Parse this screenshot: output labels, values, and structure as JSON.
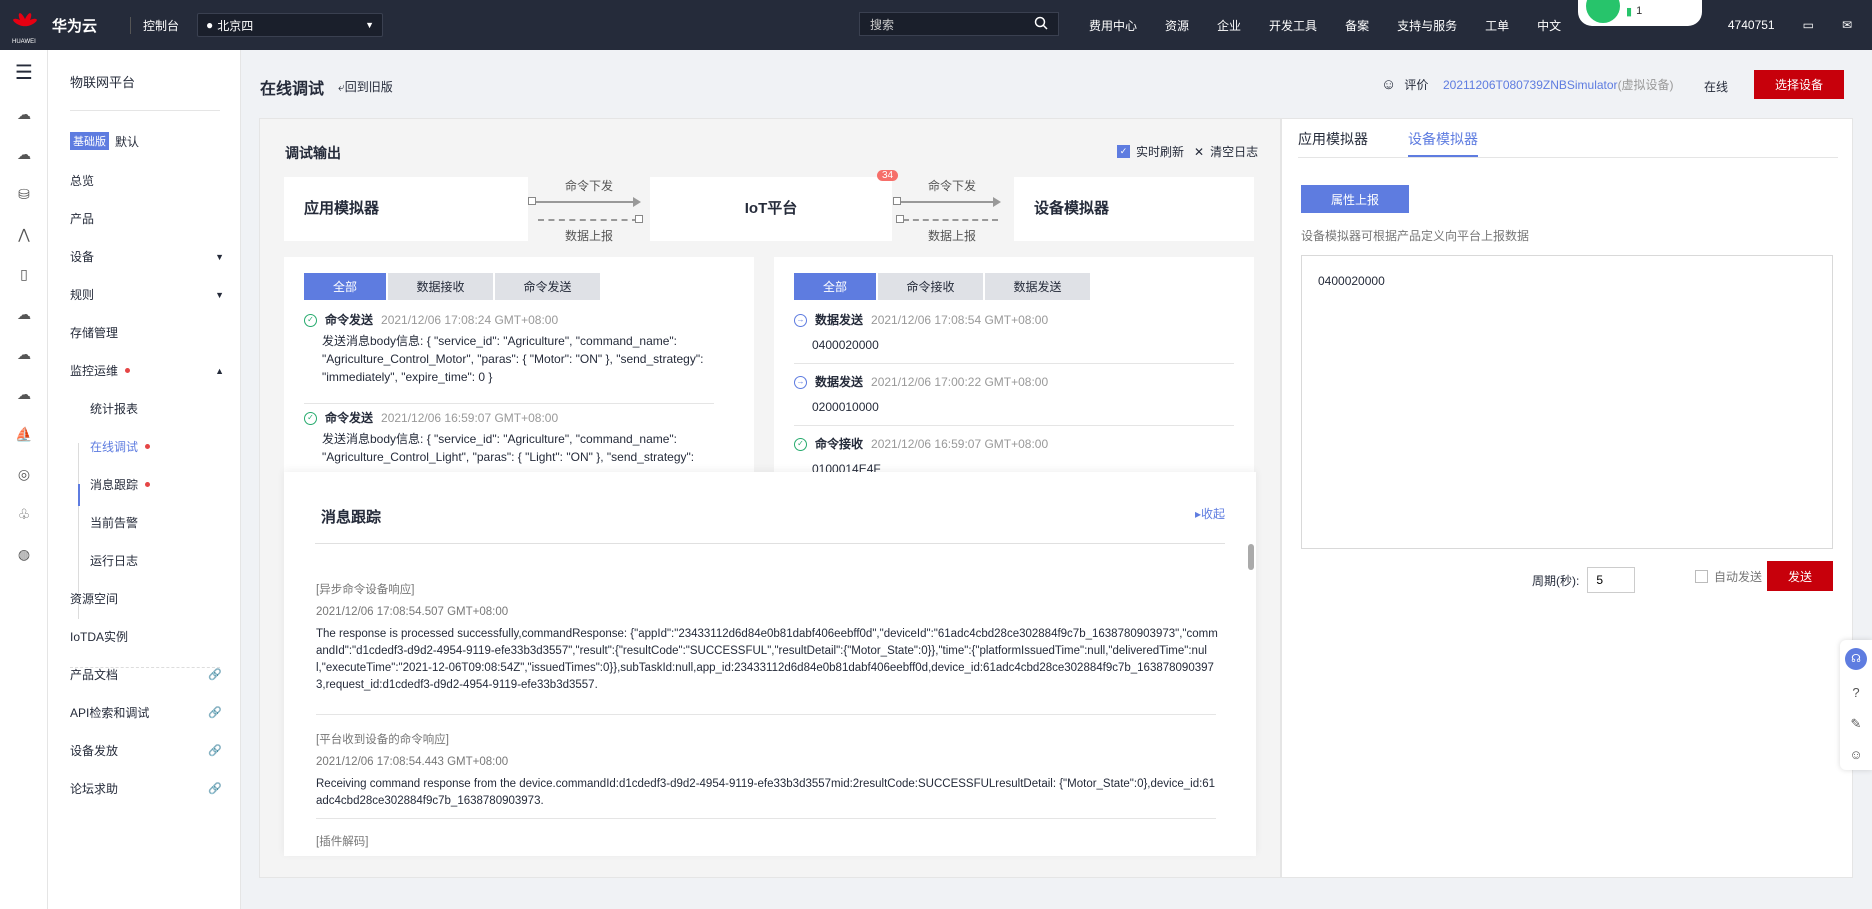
{
  "topbar": {
    "brand": "华为云",
    "brand_sub": "HUAWEI",
    "console": "控制台",
    "region": "北京四",
    "search_placeholder": "搜索",
    "nav": [
      "费用中心",
      "资源",
      "企业",
      "开发工具",
      "备案",
      "支持与服务",
      "工单",
      "中文"
    ],
    "account_tail": "4740751",
    "wifi_count": "1"
  },
  "sidebar": {
    "title": "物联网平台",
    "edition_badge": "基础版",
    "edition_name": "默认",
    "items": [
      "总览",
      "产品",
      "设备",
      "规则",
      "存储管理",
      "监控运维"
    ],
    "sub_items": [
      "统计报表",
      "在线调试",
      "消息跟踪",
      "当前告警",
      "运行日志"
    ],
    "bottom_items": [
      "资源空间",
      "IoTDA实例",
      "产品文档",
      "API检索和调试",
      "设备发放",
      "论坛求助"
    ]
  },
  "header": {
    "title": "在线调试",
    "back_old": "回到旧版",
    "rate": "评价",
    "device_name": "20211206T080739ZNBSimulator",
    "device_tag": "(虚拟设备)",
    "status": "在线",
    "select_device": "选择设备"
  },
  "debug": {
    "title": "调试输出",
    "realtime": "实时刷新",
    "clear_log": "清空日志",
    "app_sim": "应用模拟器",
    "iot_platform": "IoT平台",
    "dev_sim": "设备模拟器",
    "cmd_down": "命令下发",
    "data_up": "数据上报",
    "badge": "34",
    "left_tabs": [
      "全部",
      "数据接收",
      "命令发送"
    ],
    "right_tabs": [
      "全部",
      "命令接收",
      "数据发送"
    ],
    "left_logs": [
      {
        "type": "命令发送",
        "time": "2021/12/06 17:08:24 GMT+08:00",
        "body": "发送消息body信息: { \"service_id\": \"Agriculture\", \"command_name\": \"Agriculture_Control_Motor\", \"paras\": { \"Motor\": \"ON\" }, \"send_strategy\": \"immediately\", \"expire_time\": 0 }"
      },
      {
        "type": "命令发送",
        "time": "2021/12/06 16:59:07 GMT+08:00",
        "body": "发送消息body信息: { \"service_id\": \"Agriculture\", \"command_name\": \"Agriculture_Control_Light\", \"paras\": { \"Light\": \"ON\" }, \"send_strategy\":"
      }
    ],
    "right_logs": [
      {
        "type": "数据发送",
        "time": "2021/12/06 17:08:54 GMT+08:00",
        "body": "0400020000"
      },
      {
        "type": "数据发送",
        "time": "2021/12/06 17:00:22 GMT+08:00",
        "body": "0200010000"
      },
      {
        "type": "命令接收",
        "time": "2021/12/06 16:59:07 GMT+08:00",
        "body": "0100014E4F"
      }
    ]
  },
  "trace": {
    "title": "消息跟踪",
    "collapse": "收起",
    "entries": [
      {
        "tag": "[异步命令设备响应]",
        "time": "2021/12/06 17:08:54.507 GMT+08:00",
        "body": "The response is processed successfully,commandResponse: {\"appId\":\"23433112d6d84e0b81dabf406eebff0d\",\"deviceId\":\"61adc4cbd28ce302884f9c7b_1638780903973\",\"commandId\":\"d1cdedf3-d9d2-4954-9119-efe33b3d3557\",\"result\":{\"resultCode\":\"SUCCESSFUL\",\"resultDetail\":{\"Motor_State\":0}},\"time\":{\"platformIssuedTime\":null,\"deliveredTime\":null,\"executeTime\":\"2021-12-06T09:08:54Z\",\"issuedTimes\":0}},subTaskId:null,app_id:23433112d6d84e0b81dabf406eebff0d,device_id:61adc4cbd28ce302884f9c7b_1638780903973,request_id:d1cdedf3-d9d2-4954-9119-efe33b3d3557."
      },
      {
        "tag": "[平台收到设备的命令响应]",
        "time": "2021/12/06 17:08:54.443 GMT+08:00",
        "body": "Receiving command response from the device.commandId:d1cdedf3-d9d2-4954-9119-efe33b3d3557mid:2resultCode:SUCCESSFULresultDetail: {\"Motor_State\":0},device_id:61adc4cbd28ce302884f9c7b_1638780903973."
      },
      {
        "tag": "[插件解码]",
        "time": "",
        "body": ""
      }
    ]
  },
  "right": {
    "tabs": [
      "应用模拟器",
      "设备模拟器"
    ],
    "prop_report": "属性上报",
    "hint": "设备模拟器可根据产品定义向平台上报数据",
    "payload": "0400020000",
    "period_label": "周期(秒):",
    "period_value": "5",
    "auto_send": "自动发送",
    "send": "发送"
  }
}
